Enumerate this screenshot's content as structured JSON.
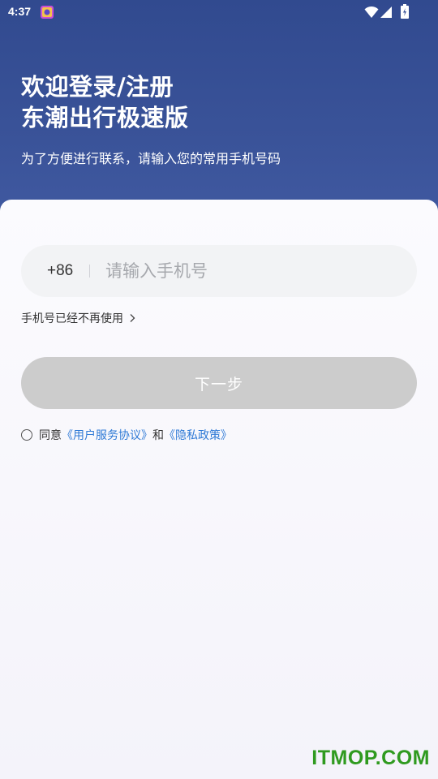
{
  "status_bar": {
    "time": "4:37",
    "icons": [
      "app-notification-icon",
      "wifi-icon",
      "signal-icon",
      "battery-icon"
    ]
  },
  "header": {
    "title_line1": "欢迎登录/注册",
    "title_line2": "东潮出行极速版",
    "subtitle": "为了方便进行联系，请输入您的常用手机号码"
  },
  "login_form": {
    "country_code": "+86",
    "phone_value": "",
    "phone_placeholder": "请输入手机号",
    "no_longer_label": "手机号已经不再使用",
    "next_label": "下一步",
    "next_button_color": "#cccccc"
  },
  "agreement": {
    "prefix": "同意",
    "user_agreement": "《用户服务协议》",
    "and": "和",
    "privacy_policy": "《隐私政策》",
    "link_color": "#2f7ad6",
    "checked": false
  },
  "watermark": {
    "text": "ITMOP.COM"
  },
  "colors": {
    "header_background": "#314a8f",
    "accent_link": "#2f7ad6",
    "watermark": "#2f9a1f"
  }
}
